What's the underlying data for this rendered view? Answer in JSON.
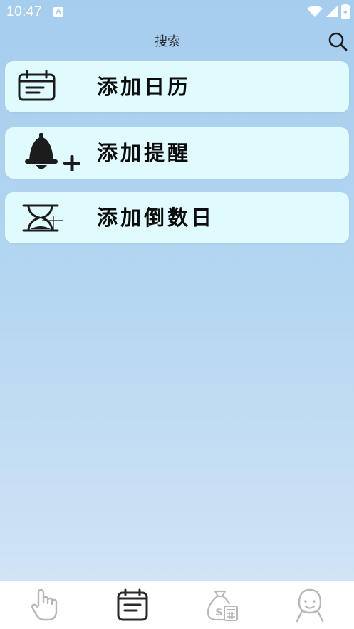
{
  "status_bar": {
    "time": "10:47",
    "app_icon_letter": "A",
    "icons": [
      "wifi-icon",
      "signal-icon",
      "battery-icon"
    ]
  },
  "header": {
    "title": "搜索",
    "search_icon": "search-icon"
  },
  "cards": [
    {
      "label": "添加日历",
      "icon": "calendar-icon"
    },
    {
      "label": "添加提醒",
      "icon": "bell-add-icon"
    },
    {
      "label": "添加倒数日",
      "icon": "hourglass-icon"
    }
  ],
  "tabbar": {
    "tabs": [
      {
        "icon": "hand-pointer-icon",
        "active": false
      },
      {
        "icon": "calendar-icon",
        "active": true
      },
      {
        "icon": "money-bag-icon",
        "active": false
      },
      {
        "icon": "person-icon",
        "active": false
      }
    ]
  },
  "colors": {
    "background_top": "#a5cdee",
    "background_bottom": "#d4e6f6",
    "card_bg": "#e0fbfe",
    "active_tab": "#2a2a2a",
    "inactive_tab": "#b8b8b8"
  }
}
